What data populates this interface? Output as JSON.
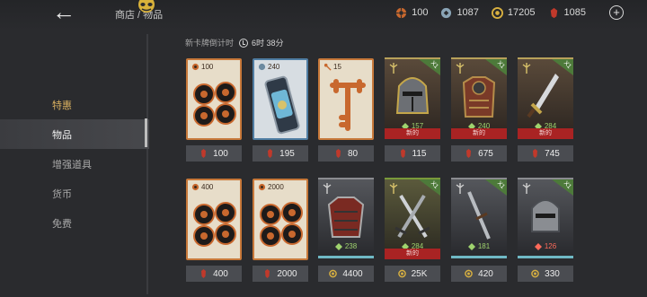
{
  "header": {
    "back_label": "←",
    "breadcrumb": "商店 / 物品",
    "currencies": [
      {
        "icon": "steel-coin-icon",
        "value": "100",
        "color": "#c8682e"
      },
      {
        "icon": "tech-gem-icon",
        "value": "1087",
        "color": "#8aa4b6"
      },
      {
        "icon": "gold-coin-icon",
        "value": "17205",
        "color": "#d8b040"
      },
      {
        "icon": "ruby-icon",
        "value": "1085",
        "color": "#c0392b"
      }
    ],
    "add_label": "+"
  },
  "sidebar": {
    "items": [
      {
        "label": "特惠",
        "state": "highlight"
      },
      {
        "label": "物品",
        "state": "active"
      },
      {
        "label": "增强道具",
        "state": "normal"
      },
      {
        "label": "货币",
        "state": "normal"
      },
      {
        "label": "免费",
        "state": "normal"
      }
    ]
  },
  "timer": {
    "label": "新卡牌倒计时",
    "value": "6时 38分"
  },
  "row1": [
    {
      "kind": "coins",
      "qty": "100",
      "price": "100",
      "price_icon": "ruby-icon"
    },
    {
      "kind": "capsule",
      "qty": "240",
      "price": "195",
      "price_icon": "ruby-icon"
    },
    {
      "kind": "key",
      "qty": "15",
      "price": "80",
      "price_icon": "ruby-icon"
    },
    {
      "kind": "helmet-hero",
      "power": "157",
      "x": "X1",
      "new": "新的",
      "price": "115",
      "price_icon": "ruby-icon"
    },
    {
      "kind": "armor-hero",
      "power": "240",
      "x": "X1",
      "new": "新的",
      "price": "675",
      "price_icon": "ruby-icon"
    },
    {
      "kind": "sword-hero",
      "power": "284",
      "x": "X1",
      "new": "新的",
      "price": "745",
      "price_icon": "ruby-icon"
    }
  ],
  "row2": [
    {
      "kind": "coins",
      "qty": "400",
      "price": "400",
      "price_icon": "ruby-icon"
    },
    {
      "kind": "coins",
      "qty": "2000",
      "price": "2000",
      "price_icon": "ruby-icon"
    },
    {
      "kind": "chest-hero",
      "power": "238",
      "price": "4400",
      "price_icon": "gold-coin-icon"
    },
    {
      "kind": "dualsword-hero",
      "power": "284",
      "x": "X1",
      "new": "新的",
      "price": "25K",
      "price_icon": "gold-coin-icon"
    },
    {
      "kind": "greatsword-hero",
      "power": "181",
      "x": "X1",
      "price": "420",
      "price_icon": "gold-coin-icon"
    },
    {
      "kind": "grey-helmet-hero",
      "power": "126",
      "x": "X1",
      "price": "330",
      "price_icon": "gold-coin-icon"
    }
  ]
}
